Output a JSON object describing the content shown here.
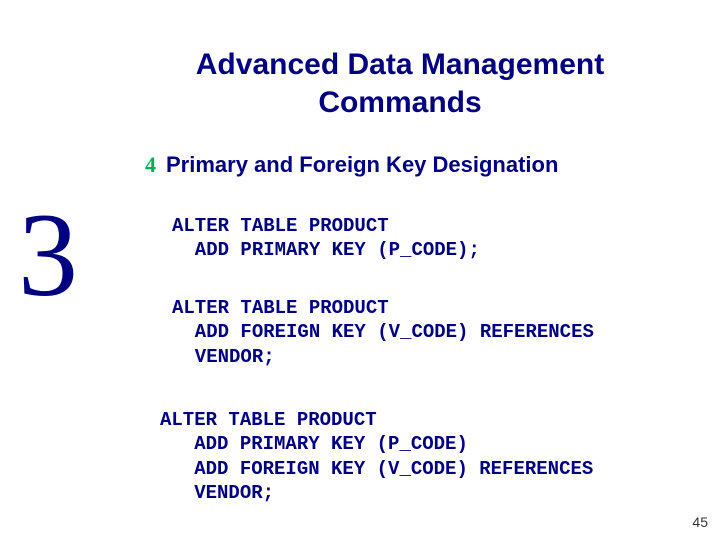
{
  "chapter_number": "3",
  "title_line1": "Advanced Data Management",
  "title_line2": "Commands",
  "bullet_marker": "4",
  "bullet_text": "Primary and Foreign Key Designation",
  "code_block_1": "ALTER TABLE PRODUCT\n  ADD PRIMARY KEY (P_CODE);",
  "code_block_2": "ALTER TABLE PRODUCT\n  ADD FOREIGN KEY (V_CODE) REFERENCES\n  VENDOR;",
  "code_block_3": "ALTER TABLE PRODUCT\n   ADD PRIMARY KEY (P_CODE)\n   ADD FOREIGN KEY (V_CODE) REFERENCES\n   VENDOR;",
  "page_number": "45"
}
